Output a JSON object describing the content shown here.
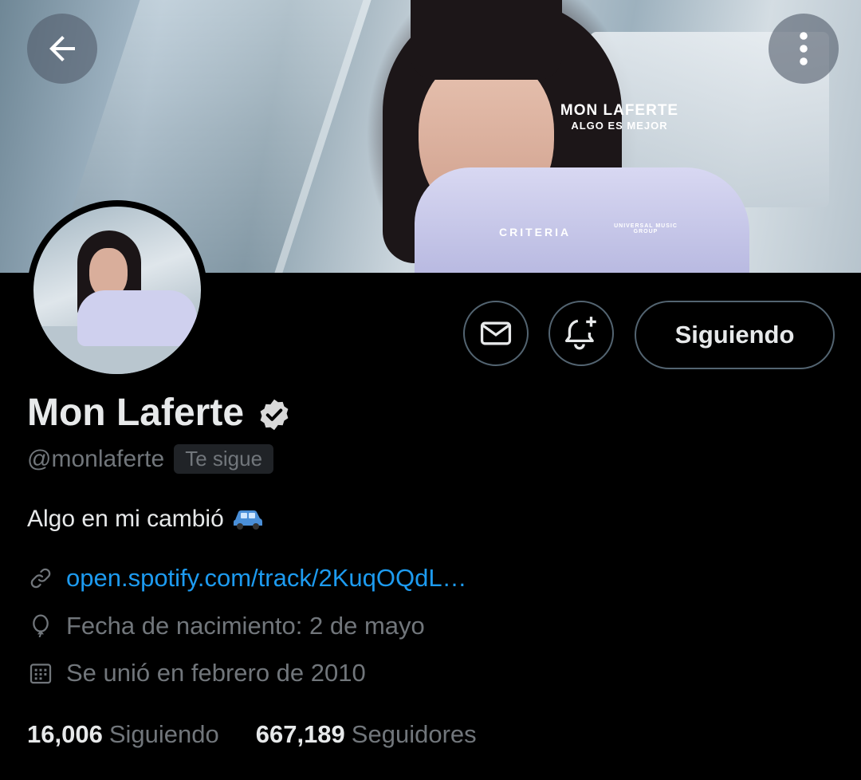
{
  "banner": {
    "album_title": "MON LAFERTE",
    "album_subtitle": "ALGO ES MEJOR",
    "label_left": "CRITERIA",
    "label_right": "UNIVERSAL MUSIC GROUP"
  },
  "header": {
    "back_icon": "arrow-left-icon",
    "more_icon": "more-vertical-icon"
  },
  "actions": {
    "message_icon": "envelope-icon",
    "notify_icon": "bell-plus-icon",
    "follow_label": "Siguiendo"
  },
  "profile": {
    "display_name": "Mon Laferte",
    "verified": true,
    "handle": "@monlaferte",
    "follows_you": "Te sigue",
    "bio": "Algo en mi cambió",
    "bio_emoji": "🚙",
    "link": "open.spotify.com/track/2KuqOQdL…",
    "birthday": "Fecha de nacimiento: 2 de mayo",
    "joined": "Se unió en febrero de 2010"
  },
  "stats": {
    "following_count": "16,006",
    "following_label": "Siguiendo",
    "followers_count": "667,189",
    "followers_label": "Seguidores"
  },
  "colors": {
    "background": "#000000",
    "text_primary": "#e7e9ea",
    "text_secondary": "#71767b",
    "link": "#1d9bf0",
    "border": "#536471"
  }
}
